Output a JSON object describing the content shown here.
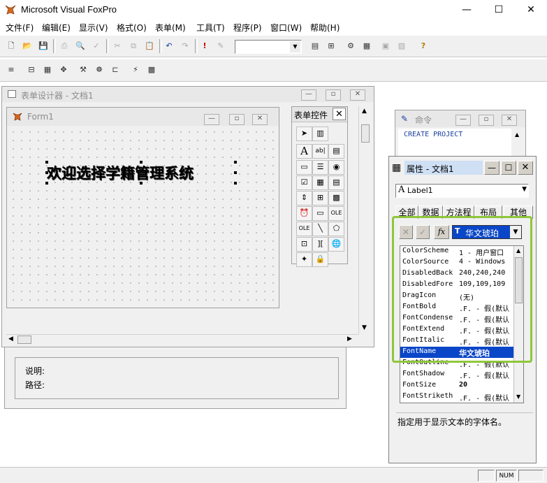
{
  "app": {
    "title": "Microsoft Visual FoxPro",
    "minimize": "—",
    "maximize": "☐",
    "close": "✕"
  },
  "menu": [
    "文件(F)",
    "编辑(E)",
    "显示(V)",
    "格式(O)",
    "表单(M)",
    "工具(T)",
    "程序(P)",
    "窗口(W)",
    "帮助(H)"
  ],
  "toolbar": {
    "combo_value": ""
  },
  "form_designer": {
    "title": "表单设计器 - 文档1",
    "form_title": "Form1",
    "label_text": "欢迎选择学籍管理系统"
  },
  "controls_palette": {
    "title": "表单控件",
    "close": "✕"
  },
  "project_panel": {
    "description_label": "说明:",
    "path_label": "路径:"
  },
  "command_window": {
    "title": "命令",
    "text": "CREATE PROJECT"
  },
  "properties": {
    "title": "属性 - 文档1",
    "object": "Label1",
    "tabs": [
      "全部",
      "数据",
      "方法程",
      "布局",
      "其他"
    ],
    "editor_value": "华文琥珀",
    "rows": [
      {
        "name": "ColorScheme",
        "value": "1 - 用户窗口"
      },
      {
        "name": "ColorSource",
        "value": "4 - Windows"
      },
      {
        "name": "DisabledBack",
        "value": "240,240,240"
      },
      {
        "name": "DisabledFore",
        "value": "109,109,109"
      },
      {
        "name": "DragIcon",
        "value": "(无)"
      },
      {
        "name": "FontBold",
        "value": ".F. - 假(默认"
      },
      {
        "name": "FontCondense",
        "value": ".F. - 假(默认"
      },
      {
        "name": "FontExtend",
        "value": ".F. - 假(默认"
      },
      {
        "name": "FontItalic",
        "value": ".F. - 假(默认"
      },
      {
        "name": "FontName",
        "value": "华文琥珀"
      },
      {
        "name": "FontOutline",
        "value": ".F. - 假(默认"
      },
      {
        "name": "FontShadow",
        "value": ".F. - 假(默认"
      },
      {
        "name": "FontSize",
        "value": "20"
      },
      {
        "name": "FontStriketh",
        "value": ".F. - 假(默认"
      }
    ],
    "description": "指定用于显示文本的字体名。"
  },
  "statusbar": {
    "num": "NUM"
  },
  "colors": {
    "highlight": "#0a46c8",
    "annotation": "#8fc63a",
    "titlebar_blue": "#1f6fd0"
  }
}
